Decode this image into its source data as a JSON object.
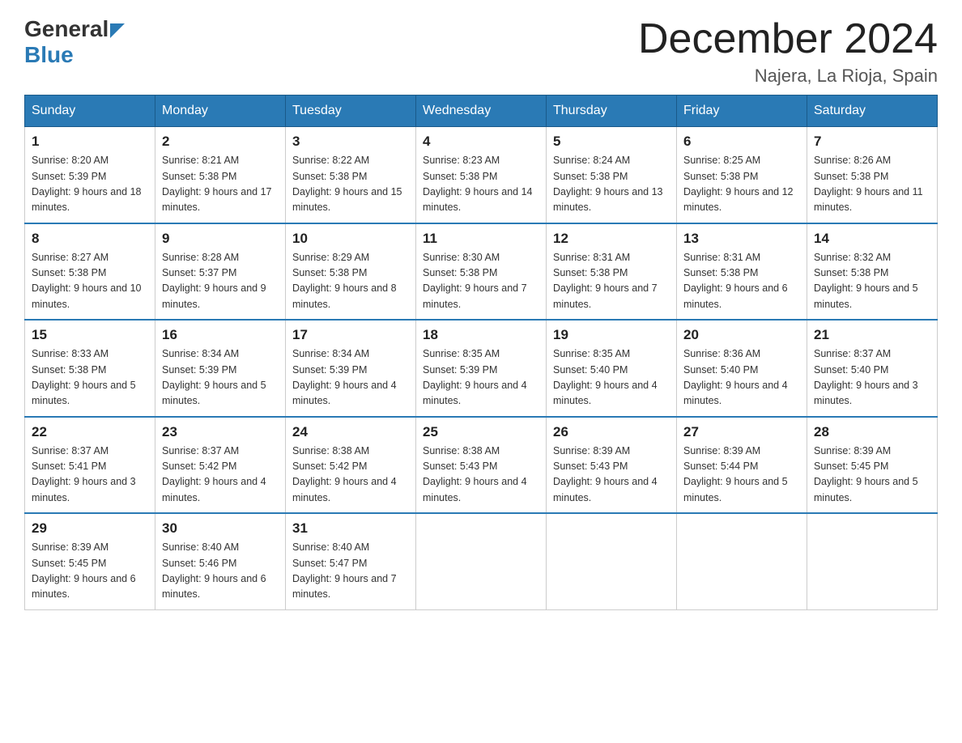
{
  "logo": {
    "general": "General",
    "arrow": "",
    "blue": "Blue"
  },
  "title": "December 2024",
  "subtitle": "Najera, La Rioja, Spain",
  "days_of_week": [
    "Sunday",
    "Monday",
    "Tuesday",
    "Wednesday",
    "Thursday",
    "Friday",
    "Saturday"
  ],
  "weeks": [
    [
      {
        "day": "1",
        "sunrise": "8:20 AM",
        "sunset": "5:39 PM",
        "daylight": "9 hours and 18 minutes."
      },
      {
        "day": "2",
        "sunrise": "8:21 AM",
        "sunset": "5:38 PM",
        "daylight": "9 hours and 17 minutes."
      },
      {
        "day": "3",
        "sunrise": "8:22 AM",
        "sunset": "5:38 PM",
        "daylight": "9 hours and 15 minutes."
      },
      {
        "day": "4",
        "sunrise": "8:23 AM",
        "sunset": "5:38 PM",
        "daylight": "9 hours and 14 minutes."
      },
      {
        "day": "5",
        "sunrise": "8:24 AM",
        "sunset": "5:38 PM",
        "daylight": "9 hours and 13 minutes."
      },
      {
        "day": "6",
        "sunrise": "8:25 AM",
        "sunset": "5:38 PM",
        "daylight": "9 hours and 12 minutes."
      },
      {
        "day": "7",
        "sunrise": "8:26 AM",
        "sunset": "5:38 PM",
        "daylight": "9 hours and 11 minutes."
      }
    ],
    [
      {
        "day": "8",
        "sunrise": "8:27 AM",
        "sunset": "5:38 PM",
        "daylight": "9 hours and 10 minutes."
      },
      {
        "day": "9",
        "sunrise": "8:28 AM",
        "sunset": "5:37 PM",
        "daylight": "9 hours and 9 minutes."
      },
      {
        "day": "10",
        "sunrise": "8:29 AM",
        "sunset": "5:38 PM",
        "daylight": "9 hours and 8 minutes."
      },
      {
        "day": "11",
        "sunrise": "8:30 AM",
        "sunset": "5:38 PM",
        "daylight": "9 hours and 7 minutes."
      },
      {
        "day": "12",
        "sunrise": "8:31 AM",
        "sunset": "5:38 PM",
        "daylight": "9 hours and 7 minutes."
      },
      {
        "day": "13",
        "sunrise": "8:31 AM",
        "sunset": "5:38 PM",
        "daylight": "9 hours and 6 minutes."
      },
      {
        "day": "14",
        "sunrise": "8:32 AM",
        "sunset": "5:38 PM",
        "daylight": "9 hours and 5 minutes."
      }
    ],
    [
      {
        "day": "15",
        "sunrise": "8:33 AM",
        "sunset": "5:38 PM",
        "daylight": "9 hours and 5 minutes."
      },
      {
        "day": "16",
        "sunrise": "8:34 AM",
        "sunset": "5:39 PM",
        "daylight": "9 hours and 5 minutes."
      },
      {
        "day": "17",
        "sunrise": "8:34 AM",
        "sunset": "5:39 PM",
        "daylight": "9 hours and 4 minutes."
      },
      {
        "day": "18",
        "sunrise": "8:35 AM",
        "sunset": "5:39 PM",
        "daylight": "9 hours and 4 minutes."
      },
      {
        "day": "19",
        "sunrise": "8:35 AM",
        "sunset": "5:40 PM",
        "daylight": "9 hours and 4 minutes."
      },
      {
        "day": "20",
        "sunrise": "8:36 AM",
        "sunset": "5:40 PM",
        "daylight": "9 hours and 4 minutes."
      },
      {
        "day": "21",
        "sunrise": "8:37 AM",
        "sunset": "5:40 PM",
        "daylight": "9 hours and 3 minutes."
      }
    ],
    [
      {
        "day": "22",
        "sunrise": "8:37 AM",
        "sunset": "5:41 PM",
        "daylight": "9 hours and 3 minutes."
      },
      {
        "day": "23",
        "sunrise": "8:37 AM",
        "sunset": "5:42 PM",
        "daylight": "9 hours and 4 minutes."
      },
      {
        "day": "24",
        "sunrise": "8:38 AM",
        "sunset": "5:42 PM",
        "daylight": "9 hours and 4 minutes."
      },
      {
        "day": "25",
        "sunrise": "8:38 AM",
        "sunset": "5:43 PM",
        "daylight": "9 hours and 4 minutes."
      },
      {
        "day": "26",
        "sunrise": "8:39 AM",
        "sunset": "5:43 PM",
        "daylight": "9 hours and 4 minutes."
      },
      {
        "day": "27",
        "sunrise": "8:39 AM",
        "sunset": "5:44 PM",
        "daylight": "9 hours and 5 minutes."
      },
      {
        "day": "28",
        "sunrise": "8:39 AM",
        "sunset": "5:45 PM",
        "daylight": "9 hours and 5 minutes."
      }
    ],
    [
      {
        "day": "29",
        "sunrise": "8:39 AM",
        "sunset": "5:45 PM",
        "daylight": "9 hours and 6 minutes."
      },
      {
        "day": "30",
        "sunrise": "8:40 AM",
        "sunset": "5:46 PM",
        "daylight": "9 hours and 6 minutes."
      },
      {
        "day": "31",
        "sunrise": "8:40 AM",
        "sunset": "5:47 PM",
        "daylight": "9 hours and 7 minutes."
      },
      null,
      null,
      null,
      null
    ]
  ],
  "labels": {
    "sunrise": "Sunrise:",
    "sunset": "Sunset:",
    "daylight": "Daylight:"
  }
}
